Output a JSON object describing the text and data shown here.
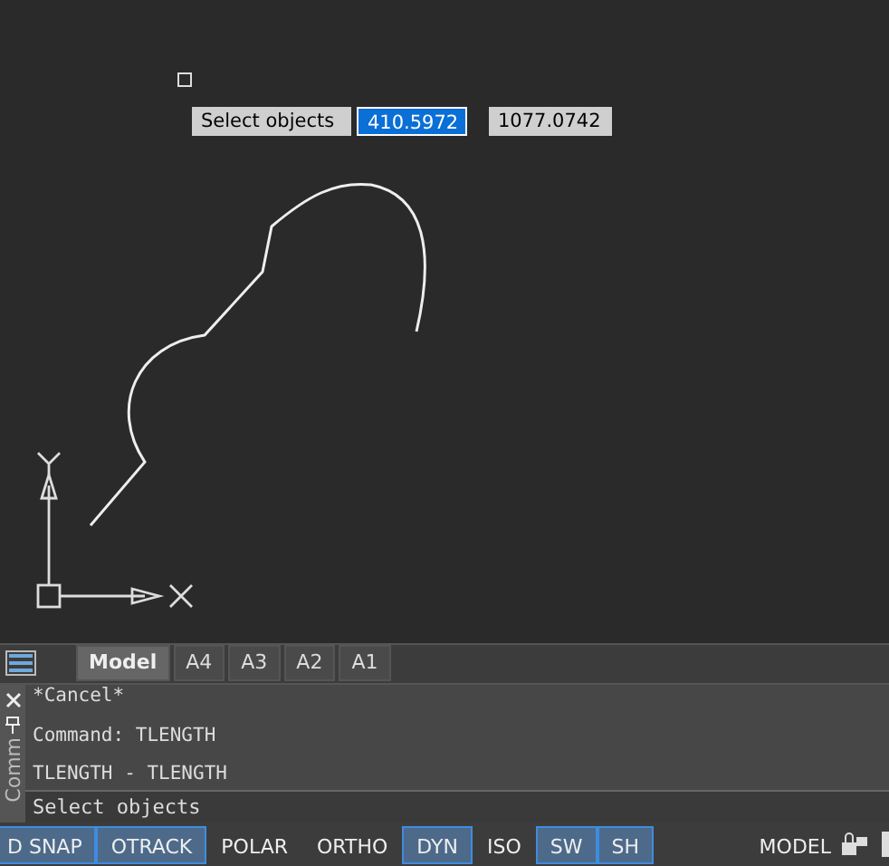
{
  "dynamic_input": {
    "prompt": "Select objects",
    "fields": [
      {
        "value": "410.5972",
        "selected": true
      },
      {
        "value": "1077.0742",
        "selected": false
      }
    ]
  },
  "layout_tabs": [
    {
      "label": "Model",
      "selected": true
    },
    {
      "label": "A4",
      "selected": false
    },
    {
      "label": "A3",
      "selected": false
    },
    {
      "label": "A2",
      "selected": false
    },
    {
      "label": "A1",
      "selected": false
    }
  ],
  "command_window": {
    "title": "Comm",
    "history": [
      "*Cancel*",
      "Command: TLENGTH",
      "TLENGTH - TLENGTH"
    ],
    "prompt": "Select objects"
  },
  "status_bar": {
    "toggles": [
      {
        "label": "D SNAP",
        "on": true
      },
      {
        "label": "OTRACK",
        "on": true
      },
      {
        "label": "POLAR",
        "on": false
      },
      {
        "label": "ORTHO",
        "on": false
      },
      {
        "label": "DYN",
        "on": true
      },
      {
        "label": "ISO",
        "on": false
      },
      {
        "label": "SW",
        "on": true
      },
      {
        "label": "SH",
        "on": true
      }
    ],
    "space": "MODEL"
  }
}
